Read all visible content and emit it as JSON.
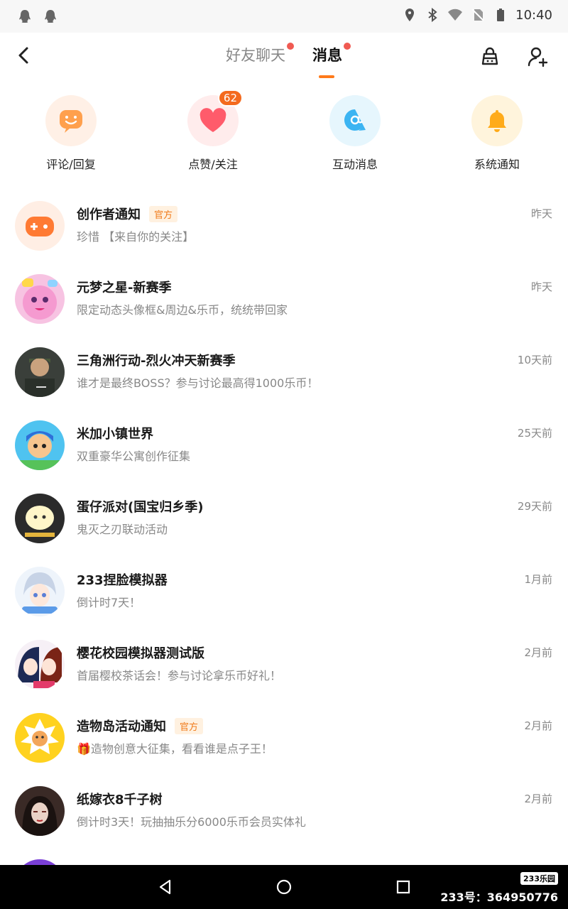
{
  "status_bar": {
    "time": "10:40",
    "left_icons": [
      "qq-icon",
      "qq-icon"
    ],
    "right_icons": [
      "location-icon",
      "bluetooth-icon",
      "wifi-icon",
      "no-sim-icon",
      "battery-icon"
    ]
  },
  "header": {
    "tabs": [
      {
        "label": "好友聊天",
        "has_dot": true,
        "active": false
      },
      {
        "label": "消息",
        "has_dot": true,
        "active": true
      }
    ],
    "right_icons": [
      "shop-bag-icon",
      "add-friend-icon"
    ],
    "accent": "#ff7a1a"
  },
  "quick": [
    {
      "label": "评论/回复",
      "icon": "comment-smile-icon",
      "bg": "#fff0e6",
      "fg": "#ff9a4a"
    },
    {
      "label": "点赞/关注",
      "icon": "heart-icon",
      "bg": "#ffecec",
      "fg": "#ff5b6b",
      "badge": "62"
    },
    {
      "label": "互动消息",
      "icon": "at-icon",
      "bg": "#e6f6fd",
      "fg": "#3bb4f2"
    },
    {
      "label": "系统通知",
      "icon": "bell-icon",
      "bg": "#fff4dc",
      "fg": "#ffab1a"
    }
  ],
  "messages": [
    {
      "title": "创作者通知",
      "official": "官方",
      "subtitle": "珍惜 【来自你的关注】",
      "time": "昨天",
      "avatar": "gamepad-icon"
    },
    {
      "title": "元梦之星-新赛季",
      "subtitle": "限定动态头像框&周边&乐币，统统带回家",
      "time": "昨天",
      "avatar": "game-avatar"
    },
    {
      "title": "三角洲行动-烈火冲天新赛季",
      "subtitle": "谁才是最终BOSS？参与讨论最高得1000乐币！",
      "time": "10天前",
      "avatar": "game-avatar"
    },
    {
      "title": "米加小镇世界",
      "subtitle": "双重豪华公寓创作征集",
      "time": "25天前",
      "avatar": "game-avatar"
    },
    {
      "title": "蛋仔派对(国宝归乡季)",
      "subtitle": "鬼灭之刃联动活动",
      "time": "29天前",
      "avatar": "game-avatar"
    },
    {
      "title": "233捏脸模拟器",
      "subtitle": "倒计时7天！",
      "time": "1月前",
      "avatar": "game-avatar"
    },
    {
      "title": "樱花校园模拟器测试版",
      "subtitle": "首届樱校茶话会！参与讨论拿乐币好礼！",
      "time": "2月前",
      "avatar": "game-avatar"
    },
    {
      "title": "造物岛活动通知",
      "official": "官方",
      "subtitle": "🎁造物创意大征集，看看谁是点子王！",
      "time": "2月前",
      "avatar": "game-avatar"
    },
    {
      "title": "纸嫁衣8千子树",
      "subtitle": "倒计时3天！玩抽抽乐分6000乐币会员实体礼",
      "time": "2月前",
      "avatar": "game-avatar"
    }
  ],
  "nav": {
    "buttons": [
      "back-triangle-icon",
      "home-circle-icon",
      "recents-square-icon"
    ],
    "watermark_logo": "233乐园",
    "watermark_text": "233号：364950776"
  }
}
